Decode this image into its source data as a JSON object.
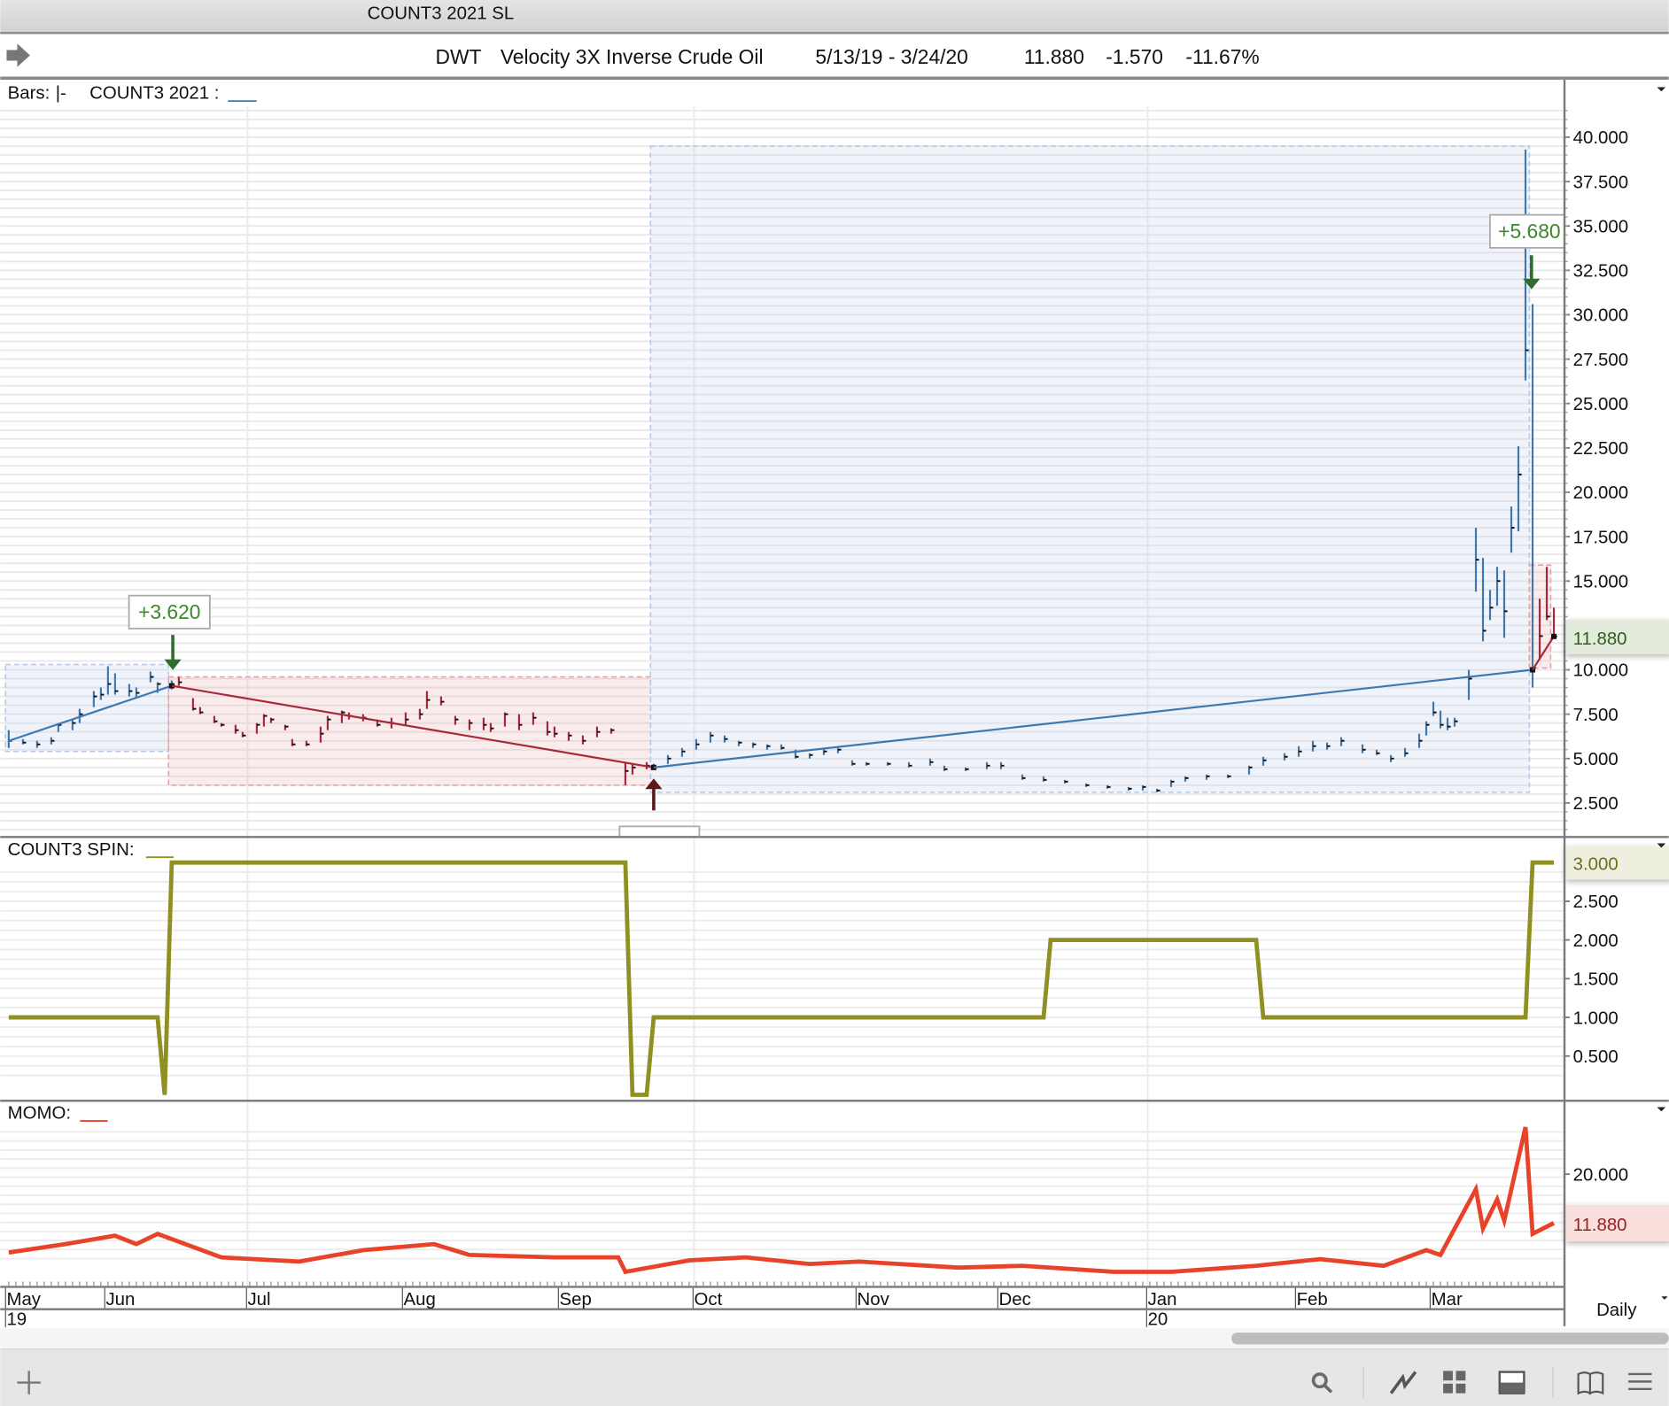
{
  "window": {
    "title": "COUNT3 2021 SL"
  },
  "header": {
    "symbol": "DWT",
    "name": "Velocity 3X Inverse Crude Oil",
    "range": "5/13/19 - 3/24/20",
    "last": "11.880",
    "change": "-1.570",
    "change_pct": "-11.67%",
    "nav_icon": "arrow-right-icon"
  },
  "panels": {
    "price_legend": {
      "bars_label": "Bars:",
      "bars_glyph": "|-",
      "study_label": "COUNT3 2021 :"
    },
    "spin_legend": {
      "label": "COUNT3 SPIN:"
    },
    "momo_legend": {
      "label": "MOMO:"
    }
  },
  "timeframe": "Daily",
  "toolbar": {
    "icons": [
      "plus-icon",
      "search-icon",
      "line-chart-icon",
      "grid-icon",
      "panel-icon",
      "book-icon",
      "menu-icon"
    ]
  },
  "colors": {
    "up_trade": "#3f78b0",
    "down_trade": "#a8283a",
    "spin": "#8f8f22",
    "momo": "#e8432a",
    "gain_label": "#3a8a2a",
    "arrow_green": "#2f6e2f",
    "arrow_dark": "#5a1a1a"
  },
  "chart_data": [
    {
      "type": "bar",
      "title": "DWT daily OHLC with COUNT3 2021 trades",
      "x_unit": "trading day index from 5/13/19",
      "x_range": [
        0,
        218
      ],
      "months": [
        {
          "label": "May",
          "day": 0
        },
        {
          "label": "Jun",
          "day": 14
        },
        {
          "label": "Jul",
          "day": 34
        },
        {
          "label": "Aug",
          "day": 56
        },
        {
          "label": "Sep",
          "day": 78
        },
        {
          "label": "Oct",
          "day": 97
        },
        {
          "label": "Nov",
          "day": 120
        },
        {
          "label": "Dec",
          "day": 140
        },
        {
          "label": "Jan",
          "day": 161
        },
        {
          "label": "Feb",
          "day": 182
        },
        {
          "label": "Mar",
          "day": 201
        }
      ],
      "years": [
        {
          "label": "19",
          "day": 0
        },
        {
          "label": "20",
          "day": 161
        }
      ],
      "ylim": [
        0,
        42.5
      ],
      "yticks": [
        "40.000",
        "37.500",
        "35.000",
        "32.500",
        "30.000",
        "27.500",
        "25.000",
        "22.500",
        "20.000",
        "17.500",
        "15.000",
        "10.000",
        "7.500",
        "5.000",
        "2.500"
      ],
      "last_value": "11.880",
      "bars_day_high_low_close": [
        [
          0,
          6.6,
          5.6,
          6.0
        ],
        [
          2,
          6.1,
          5.8,
          5.9
        ],
        [
          4,
          6.0,
          5.6,
          5.8
        ],
        [
          6,
          6.2,
          5.8,
          6.0
        ],
        [
          7,
          7.0,
          6.5,
          6.9
        ],
        [
          9,
          7.2,
          6.6,
          7.0
        ],
        [
          10,
          7.8,
          7.0,
          7.5
        ],
        [
          12,
          8.8,
          7.9,
          8.5
        ],
        [
          13,
          9.0,
          8.3,
          8.6
        ],
        [
          14,
          10.2,
          8.6,
          9.2
        ],
        [
          15,
          9.8,
          8.6,
          8.8
        ],
        [
          17,
          9.2,
          8.5,
          8.8
        ],
        [
          18,
          9.0,
          8.4,
          8.7
        ],
        [
          20,
          9.9,
          9.3,
          9.6
        ],
        [
          21,
          9.3,
          8.7,
          9.2
        ],
        [
          23,
          9.4,
          8.9,
          9.1
        ],
        [
          24,
          9.6,
          9.1,
          9.3
        ],
        [
          26,
          8.4,
          7.7,
          7.8
        ],
        [
          27,
          7.9,
          7.5,
          7.6
        ],
        [
          29,
          7.4,
          7.0,
          7.1
        ],
        [
          30,
          7.0,
          6.8,
          6.9
        ],
        [
          32,
          6.9,
          6.4,
          6.6
        ],
        [
          33,
          6.5,
          6.2,
          6.3
        ],
        [
          35,
          7.0,
          6.4,
          6.9
        ],
        [
          36,
          7.5,
          6.8,
          7.4
        ],
        [
          37,
          7.3,
          7.0,
          7.2
        ],
        [
          39,
          6.9,
          6.6,
          6.8
        ],
        [
          40,
          6.1,
          5.7,
          5.8
        ],
        [
          42,
          6.0,
          5.7,
          5.8
        ],
        [
          44,
          6.8,
          5.9,
          6.4
        ],
        [
          45,
          7.4,
          6.6,
          7.2
        ],
        [
          47,
          7.7,
          7.0,
          7.6
        ],
        [
          48,
          7.6,
          7.2,
          7.4
        ],
        [
          50,
          7.5,
          7.1,
          7.3
        ],
        [
          52,
          7.2,
          6.8,
          6.9
        ],
        [
          54,
          7.3,
          6.7,
          7.0
        ],
        [
          56,
          7.6,
          6.9,
          7.2
        ],
        [
          58,
          7.8,
          7.2,
          7.5
        ],
        [
          59,
          8.8,
          7.8,
          8.3
        ],
        [
          61,
          8.5,
          8.0,
          8.2
        ],
        [
          63,
          7.4,
          6.9,
          7.2
        ],
        [
          65,
          7.2,
          6.6,
          7.0
        ],
        [
          67,
          7.3,
          6.6,
          6.9
        ],
        [
          68,
          7.0,
          6.5,
          6.7
        ],
        [
          70,
          7.6,
          6.8,
          7.5
        ],
        [
          72,
          7.5,
          6.6,
          6.9
        ],
        [
          74,
          7.6,
          6.9,
          7.3
        ],
        [
          76,
          7.1,
          6.3,
          6.5
        ],
        [
          77,
          6.8,
          6.2,
          6.4
        ],
        [
          79,
          6.5,
          6.0,
          6.3
        ],
        [
          81,
          6.3,
          5.8,
          6.0
        ],
        [
          83,
          6.8,
          6.2,
          6.5
        ],
        [
          85,
          6.7,
          6.4,
          6.6
        ],
        [
          87,
          4.8,
          3.5,
          4.3
        ],
        [
          88,
          4.7,
          4.1,
          4.5
        ],
        [
          90,
          4.8,
          4.4,
          4.6
        ],
        [
          91,
          4.7,
          4.4,
          4.5
        ],
        [
          93,
          5.2,
          4.7,
          5.0
        ],
        [
          95,
          5.6,
          5.1,
          5.4
        ],
        [
          97,
          6.1,
          5.5,
          5.8
        ],
        [
          99,
          6.5,
          5.9,
          6.3
        ],
        [
          101,
          6.3,
          5.9,
          6.1
        ],
        [
          103,
          6.0,
          5.7,
          5.9
        ],
        [
          105,
          5.9,
          5.6,
          5.8
        ],
        [
          107,
          5.8,
          5.5,
          5.7
        ],
        [
          109,
          5.8,
          5.5,
          5.6
        ],
        [
          111,
          5.5,
          5.0,
          5.1
        ],
        [
          113,
          5.3,
          5.0,
          5.2
        ],
        [
          115,
          5.6,
          5.2,
          5.4
        ],
        [
          117,
          5.6,
          5.3,
          5.5
        ],
        [
          119,
          4.9,
          4.6,
          4.7
        ],
        [
          121,
          4.8,
          4.6,
          4.7
        ],
        [
          124,
          4.8,
          4.6,
          4.7
        ],
        [
          127,
          4.8,
          4.5,
          4.6
        ],
        [
          130,
          5.0,
          4.6,
          4.8
        ],
        [
          132,
          4.6,
          4.3,
          4.4
        ],
        [
          135,
          4.5,
          4.3,
          4.4
        ],
        [
          138,
          4.8,
          4.4,
          4.6
        ],
        [
          140,
          4.8,
          4.4,
          4.6
        ],
        [
          143,
          4.1,
          3.8,
          3.9
        ],
        [
          146,
          4.0,
          3.7,
          3.8
        ],
        [
          149,
          3.8,
          3.6,
          3.7
        ],
        [
          152,
          3.6,
          3.4,
          3.5
        ],
        [
          155,
          3.5,
          3.3,
          3.4
        ],
        [
          158,
          3.4,
          3.2,
          3.3
        ],
        [
          160,
          3.5,
          3.2,
          3.4
        ],
        [
          162,
          3.3,
          3.1,
          3.2
        ],
        [
          164,
          3.8,
          3.4,
          3.7
        ],
        [
          166,
          4.0,
          3.7,
          3.9
        ],
        [
          169,
          4.1,
          3.8,
          4.0
        ],
        [
          172,
          4.1,
          3.9,
          4.0
        ],
        [
          175,
          4.6,
          4.1,
          4.5
        ],
        [
          177,
          5.1,
          4.6,
          4.9
        ],
        [
          180,
          5.3,
          4.9,
          5.1
        ],
        [
          182,
          5.7,
          5.1,
          5.4
        ],
        [
          184,
          6.0,
          5.4,
          5.7
        ],
        [
          186,
          5.9,
          5.5,
          5.7
        ],
        [
          188,
          6.2,
          5.7,
          6.0
        ],
        [
          191,
          5.8,
          5.3,
          5.5
        ],
        [
          193,
          5.5,
          5.2,
          5.3
        ],
        [
          195,
          5.2,
          4.8,
          5.0
        ],
        [
          197,
          5.6,
          5.1,
          5.3
        ],
        [
          199,
          6.4,
          5.6,
          6.0
        ],
        [
          200,
          7.1,
          6.3,
          6.9
        ],
        [
          201,
          8.2,
          7.4,
          7.6
        ],
        [
          202,
          7.7,
          6.7,
          6.9
        ],
        [
          203,
          7.3,
          6.6,
          6.8
        ],
        [
          204,
          7.3,
          6.8,
          7.1
        ],
        [
          206,
          10.0,
          8.3,
          9.5
        ],
        [
          207,
          18.0,
          14.4,
          16.2
        ],
        [
          208,
          16.3,
          11.6,
          12.2
        ],
        [
          209,
          14.5,
          12.8,
          13.5
        ],
        [
          210,
          15.8,
          13.6,
          15.0
        ],
        [
          211,
          15.6,
          11.8,
          13.3
        ],
        [
          212,
          19.2,
          16.6,
          18.0
        ],
        [
          213,
          22.6,
          17.8,
          21.0
        ],
        [
          214,
          39.3,
          26.3,
          28.0
        ],
        [
          215,
          30.6,
          9.0,
          10.1
        ],
        [
          216,
          14.0,
          10.6,
          11.9
        ],
        [
          217,
          15.8,
          12.8,
          13.0
        ],
        [
          218,
          13.5,
          11.8,
          11.88
        ]
      ],
      "trades": [
        {
          "side": "long",
          "start": 0,
          "end": 23,
          "entry": 6.0,
          "exit": 9.1,
          "box": [
            5.4,
            10.3
          ]
        },
        {
          "side": "short",
          "start": 23,
          "end": 91,
          "entry": 9.1,
          "exit": 4.5,
          "box": [
            3.5,
            9.6
          ],
          "signal_label": "+3.620",
          "signal_arrow": "down"
        },
        {
          "side": "long",
          "start": 91,
          "end": 215,
          "entry": 4.5,
          "exit": 10.0,
          "box": [
            3.1,
            39.5
          ],
          "signal_arrow": "up"
        },
        {
          "side": "short",
          "start": 215,
          "end": 218,
          "entry": 10.0,
          "exit": 11.88,
          "box": [
            10.1,
            15.9
          ],
          "signal_label": "+5.680",
          "signal_arrow": "down"
        }
      ]
    },
    {
      "type": "line",
      "title": "COUNT3 SPIN",
      "ylim": [
        0,
        3.3
      ],
      "yticks": [
        "3.000",
        "2.500",
        "2.000",
        "1.500",
        "1.000",
        "0.500"
      ],
      "last_value": "3.000",
      "points_day_value": [
        [
          0,
          1
        ],
        [
          21,
          1
        ],
        [
          22,
          0
        ],
        [
          23,
          3
        ],
        [
          87,
          3
        ],
        [
          88,
          0
        ],
        [
          90,
          0
        ],
        [
          91,
          1
        ],
        [
          146,
          1
        ],
        [
          147,
          2
        ],
        [
          176,
          2
        ],
        [
          177,
          1
        ],
        [
          214,
          1
        ],
        [
          215,
          3
        ],
        [
          218,
          3
        ]
      ]
    },
    {
      "type": "line",
      "title": "MOMO",
      "ylim": [
        0,
        30
      ],
      "yticks": [
        "20.000"
      ],
      "last_value": "11.880",
      "points_day_value": [
        [
          0,
          7.0
        ],
        [
          8,
          8.4
        ],
        [
          15,
          9.8
        ],
        [
          18,
          8.4
        ],
        [
          21,
          10.1
        ],
        [
          30,
          6.2
        ],
        [
          41,
          5.5
        ],
        [
          50,
          7.4
        ],
        [
          60,
          8.4
        ],
        [
          65,
          6.6
        ],
        [
          77,
          6.2
        ],
        [
          86,
          6.2
        ],
        [
          87,
          3.8
        ],
        [
          96,
          5.7
        ],
        [
          104,
          6.2
        ],
        [
          113,
          5.1
        ],
        [
          120,
          5.5
        ],
        [
          134,
          4.5
        ],
        [
          143,
          4.8
        ],
        [
          156,
          3.8
        ],
        [
          164,
          3.8
        ],
        [
          176,
          4.8
        ],
        [
          185,
          5.9
        ],
        [
          194,
          4.8
        ],
        [
          200,
          7.4
        ],
        [
          202,
          6.6
        ],
        [
          207,
          17.5
        ],
        [
          208,
          11.0
        ],
        [
          210,
          15.8
        ],
        [
          211,
          12.3
        ],
        [
          214,
          27.8
        ],
        [
          215,
          10.1
        ],
        [
          218,
          11.9
        ]
      ]
    }
  ]
}
